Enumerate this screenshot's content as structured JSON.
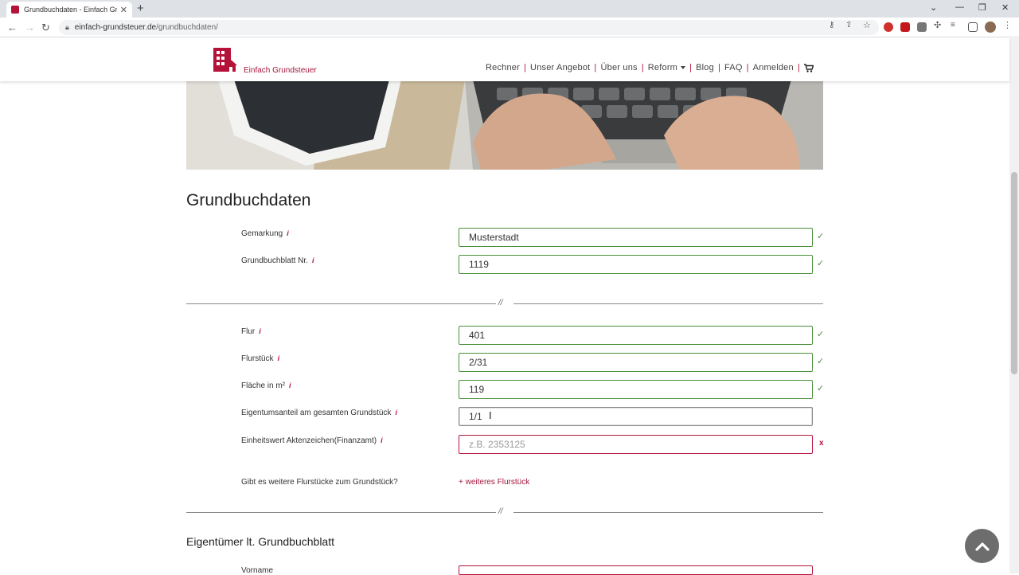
{
  "browser": {
    "tab_title": "Grundbuchdaten - Einfach Grund",
    "url_host": "einfach-grundsteuer.de",
    "url_path": "/grundbuchdaten/"
  },
  "header": {
    "logo_text": "Einfach Grundsteuer",
    "nav": [
      {
        "label": "Rechner"
      },
      {
        "label": "Unser Angebot"
      },
      {
        "label": "Über uns"
      },
      {
        "label": "Reform"
      },
      {
        "label": "Blog"
      },
      {
        "label": "FAQ"
      },
      {
        "label": "Anmelden"
      }
    ]
  },
  "section1": {
    "title": "Grundbuchdaten",
    "fields": [
      {
        "label": "Gemarkung",
        "value": "Musterstadt",
        "status": "ok"
      },
      {
        "label": "Grundbuchblatt Nr.",
        "value": "1119",
        "status": "ok"
      }
    ]
  },
  "divider_mark": "//",
  "section2": {
    "fields": [
      {
        "label": "Flur",
        "value": "401",
        "status": "ok"
      },
      {
        "label": "Flurstück",
        "value": "2/31",
        "status": "ok"
      },
      {
        "label": "Fläche in m²",
        "value": "119",
        "status": "ok"
      },
      {
        "label": "Eigentumsanteil am gesamten Grundstück",
        "value": "1/1",
        "status": "active"
      },
      {
        "label": "Einheitswert Aktenzeichen(Finanzamt)",
        "value": "",
        "placeholder": "z.B. 2353125",
        "status": "error"
      }
    ],
    "more_question": "Gibt es weitere Flurstücke zum Grundstück?",
    "more_link": "+ weiteres Flurstück"
  },
  "section3": {
    "title": "Eigentümer lt. Grundbuchblatt",
    "first_label": "Vorname"
  },
  "status_marks": {
    "ok": "✓",
    "error": "x"
  },
  "colors": {
    "brand": "#b5123a",
    "ok": "#4a8f3a"
  },
  "icons": {
    "to_top": "chevron-up-icon",
    "cart": "cart-icon"
  }
}
